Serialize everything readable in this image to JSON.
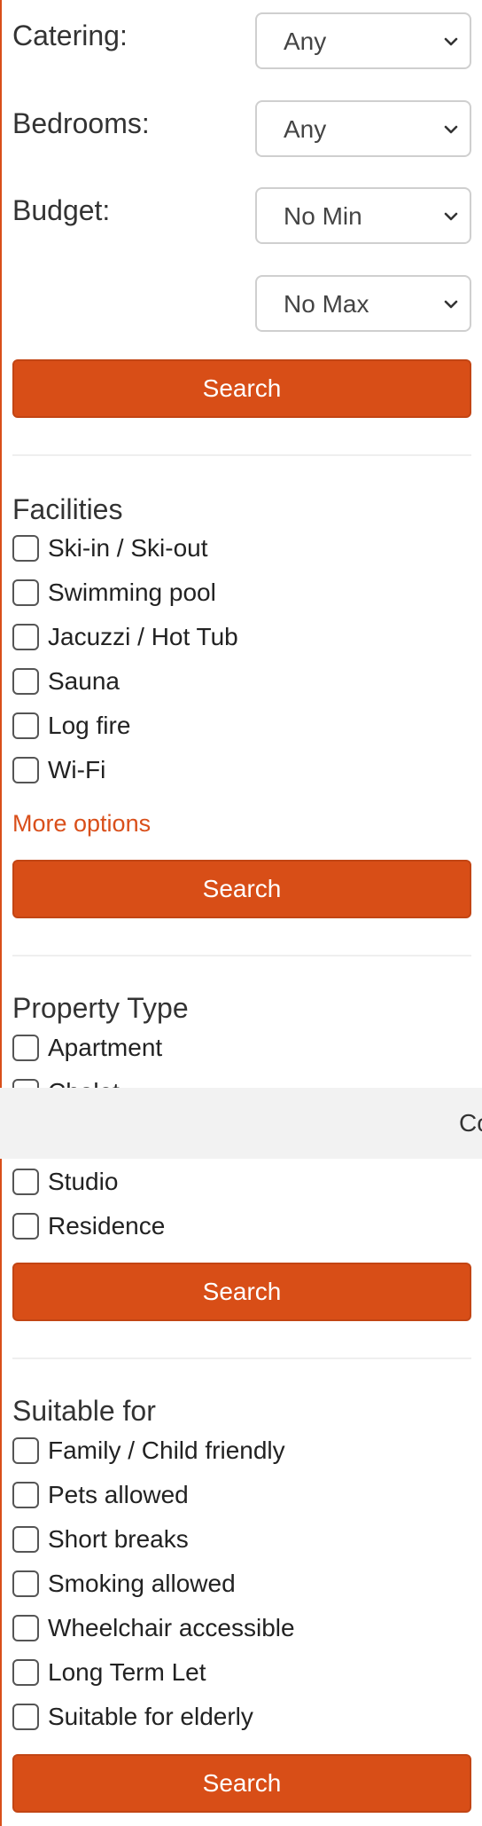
{
  "filters": {
    "catering": {
      "label": "Catering:",
      "value": "Any"
    },
    "bedrooms": {
      "label": "Bedrooms:",
      "value": "Any"
    },
    "budget": {
      "label": "Budget:",
      "min_value": "No Min",
      "max_value": "No Max"
    }
  },
  "search_label": "Search",
  "facilities": {
    "title": "Facilities",
    "items": [
      "Ski-in / Ski-out",
      "Swimming pool",
      "Jacuzzi / Hot Tub",
      "Sauna",
      "Log fire",
      "Wi-Fi"
    ],
    "more_options": "More options"
  },
  "property_type": {
    "title": "Property Type",
    "items": [
      "Apartment",
      "Chalet",
      "Studio",
      "Residence"
    ]
  },
  "suitable_for": {
    "title": "Suitable for",
    "items": [
      "Family / Child friendly",
      "Pets allowed",
      "Short breaks",
      "Smoking allowed",
      "Wheelchair accessible",
      "Long Term Let",
      "Suitable for elderly"
    ]
  },
  "cookie_banner": {
    "text": "Co"
  },
  "colors": {
    "accent": "#d84e17",
    "banner_bg": "#f2f2f2"
  }
}
